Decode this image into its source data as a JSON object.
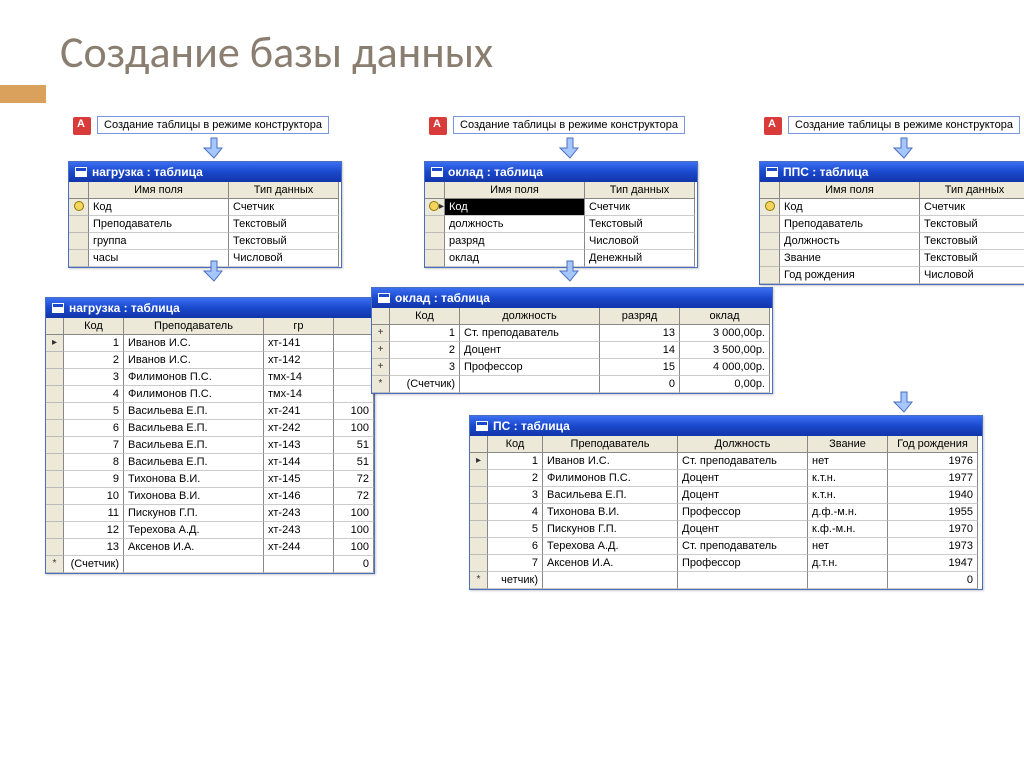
{
  "title": "Создание базы данных",
  "create_link": "Создание таблицы в режиме конструктора",
  "design_headers": {
    "field": "Имя поля",
    "type": "Тип данных"
  },
  "windows": {
    "nagruzka_design": {
      "title": "нагрузка : таблица",
      "rows": [
        {
          "field": "Код",
          "type": "Счетчик",
          "key": true
        },
        {
          "field": "Преподаватель",
          "type": "Текстовый"
        },
        {
          "field": "группа",
          "type": "Текстовый"
        },
        {
          "field": "часы",
          "type": "Числовой"
        }
      ]
    },
    "oklad_design": {
      "title": "оклад : таблица",
      "rows": [
        {
          "field": "Код",
          "type": "Счетчик",
          "key": true,
          "selected": true
        },
        {
          "field": "должность",
          "type": "Текстовый"
        },
        {
          "field": "разряд",
          "type": "Числовой"
        },
        {
          "field": "оклад",
          "type": "Денежный"
        }
      ]
    },
    "pps_design": {
      "title": "ППС : таблица",
      "rows": [
        {
          "field": "Код",
          "type": "Счетчик",
          "key": true
        },
        {
          "field": "Преподаватель",
          "type": "Текстовый"
        },
        {
          "field": "Должность",
          "type": "Текстовый"
        },
        {
          "field": "Звание",
          "type": "Текстовый"
        },
        {
          "field": "Год рождения",
          "type": "Числовой"
        }
      ]
    },
    "nagruzka_data": {
      "title": "нагрузка : таблица",
      "headers": [
        "Код",
        "Преподаватель",
        "гр"
      ],
      "rows": [
        [
          "1",
          "Иванов И.С.",
          "хт-141"
        ],
        [
          "2",
          "Иванов И.С.",
          "хт-142"
        ],
        [
          "3",
          "Филимонов П.С.",
          "тмх-14"
        ],
        [
          "4",
          "Филимонов П.С.",
          "тмх-14"
        ],
        [
          "5",
          "Васильева Е.П.",
          "хт-241"
        ],
        [
          "6",
          "Васильева Е.П.",
          "хт-242"
        ],
        [
          "7",
          "Васильева Е.П.",
          "хт-143"
        ],
        [
          "8",
          "Васильева Е.П.",
          "хт-144"
        ],
        [
          "9",
          "Тихонова В.И.",
          "хт-145"
        ],
        [
          "10",
          "Тихонова В.И.",
          "хт-146"
        ],
        [
          "11",
          "Пискунов Г.П.",
          "хт-243"
        ],
        [
          "12",
          "Терехова А.Д.",
          "хт-243"
        ],
        [
          "13",
          "Аксенов И.А.",
          "хт-244"
        ]
      ],
      "right_peek": [
        "",
        "",
        "",
        "",
        "100",
        "100",
        "51",
        "51",
        "72",
        "72",
        "100",
        "100",
        "100"
      ],
      "new_row_label": "(Счетчик)",
      "new_row_peek": "0"
    },
    "oklad_data": {
      "title": "оклад : таблица",
      "headers": [
        "Код",
        "должность",
        "разряд",
        "оклад"
      ],
      "rows": [
        [
          "1",
          "Ст. преподаватель",
          "13",
          "3 000,00р."
        ],
        [
          "2",
          "Доцент",
          "14",
          "3 500,00р."
        ],
        [
          "3",
          "Профессор",
          "15",
          "4 000,00р."
        ]
      ],
      "new_row_label": "(Счетчик)",
      "new_row_r": "0",
      "new_row_o": "0,00р."
    },
    "pps_data": {
      "title": "ПС : таблица",
      "headers": [
        "Код",
        "Преподаватель",
        "Должность",
        "Звание",
        "Год рождения"
      ],
      "rows": [
        [
          "1",
          "Иванов И.С.",
          "Ст. преподаватель",
          "нет",
          "1976"
        ],
        [
          "2",
          "Филимонов П.С.",
          "Доцент",
          "к.т.н.",
          "1977"
        ],
        [
          "3",
          "Васильева Е.П.",
          "Доцент",
          "к.т.н.",
          "1940"
        ],
        [
          "4",
          "Тихонова В.И.",
          "Профессор",
          "д.ф.-м.н.",
          "1955"
        ],
        [
          "5",
          "Пискунов Г.П.",
          "Доцент",
          "к.ф.-м.н.",
          "1970"
        ],
        [
          "6",
          "Терехова А.Д.",
          "Ст. преподаватель",
          "нет",
          "1973"
        ],
        [
          "7",
          "Аксенов И.А.",
          "Профессор",
          "д.т.н.",
          "1947"
        ]
      ],
      "new_row_label": "четчик)",
      "new_row_year": "0"
    }
  }
}
